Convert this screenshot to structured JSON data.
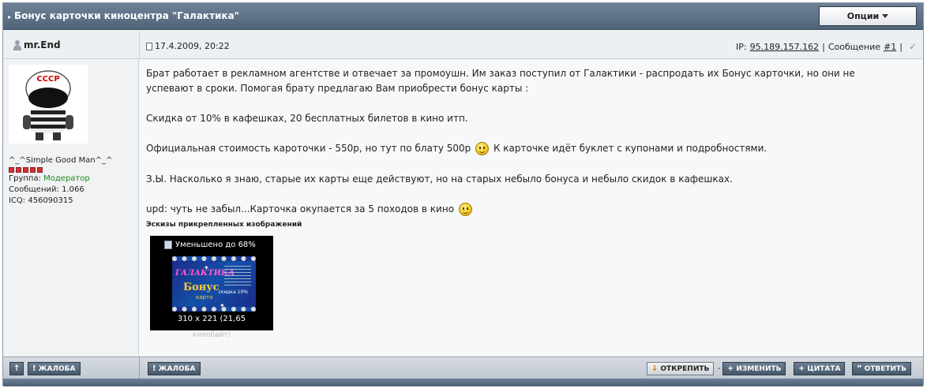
{
  "topic": {
    "title": "Бонус карточки киноцентра \"Галактика\"",
    "options_label": "Опции"
  },
  "author": {
    "name": "mr.End",
    "title": "^_^Simple Good Man^_^",
    "group_label": "Группа:",
    "group_value": "Модератор",
    "posts_label": "Сообщений:",
    "posts_value": "1.066",
    "icq_label": "ICQ:",
    "icq_value": "456090315",
    "avatar_text": "СССР"
  },
  "post": {
    "date": "17.4.2009, 20:22",
    "ip_label": "IP:",
    "ip_value": "95.189.157.162",
    "message_label": "Сообщение",
    "message_num": "#1",
    "paragraphs": [
      "Брат работает в рекламном агентстве и отвечает за промоушн. Им заказ поступил от Галактики - распродать их Бонус карточки, но они не",
      "успевают в сроки. Помогая брату предлагаю Вам приобрести бонус карты :",
      "Скидка от 10% в кафешках, 20 бесплатных билетов в кино итп.",
      "Официальная стоимость кароточки - 550р, но тут по блату 500р",
      "К карточке идёт буклет с купонами и подробностями.",
      "З.Ы. Насколько я знаю, старые их карты еще действуют, но на старых небыло бонуса и небыло скидок в кафешках.",
      "upd: чуть не забыл...Карточка окупается за 5 походов в кино"
    ],
    "attachments_title": "Эскизы прикрепленных изображений",
    "thumb_reduced": "Уменьшено до 68%",
    "thumb_size": "310 x 221 (21,65",
    "thumb_size2": "килобайт)",
    "thumb_logo": "ГАЛАКТИКА",
    "thumb_bonus": "Бонус",
    "thumb_card": "карта",
    "thumb_sale": "скидка 10%"
  },
  "buttons": {
    "up": "↑",
    "report_left": "ЖАЛОБА",
    "report_right": "ЖАЛОБА",
    "unpin": "ОТКРЕПИТЬ",
    "sep": "-",
    "edit": "ИЗМЕНИТЬ",
    "quote": "ЦИТАТА",
    "reply": "ОТВЕТИТЬ"
  },
  "colors": {
    "header_bg": "#506479",
    "button_bg": "#46586c",
    "group_color": "#1a8a1a",
    "pip_color": "#d43434"
  }
}
